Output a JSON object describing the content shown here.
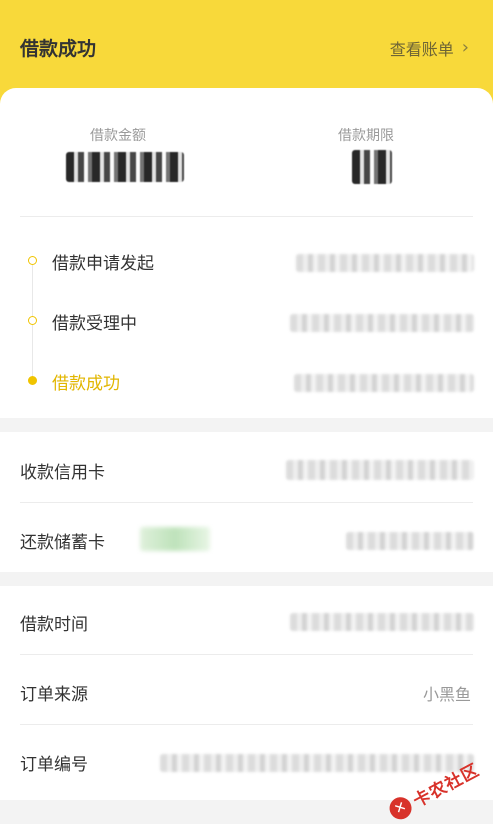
{
  "header": {
    "title": "借款成功",
    "view_bill_label": "查看账单",
    "chevron": "chevron-right-icon"
  },
  "summary": {
    "amount_label": "借款金额",
    "term_label": "借款期限"
  },
  "progress": {
    "steps": [
      {
        "label": "借款申请发起",
        "state": "done"
      },
      {
        "label": "借款受理中",
        "state": "done"
      },
      {
        "label": "借款成功",
        "state": "current"
      }
    ]
  },
  "cards": {
    "receive_label": "收款信用卡",
    "repay_label": "还款储蓄卡"
  },
  "order": {
    "time_label": "借款时间",
    "source_label": "订单来源",
    "source_value": "小黑鱼",
    "number_label": "订单编号"
  },
  "watermark": {
    "text": "卡农社区",
    "icon": "kanong-logo-icon",
    "color": "#d8322a"
  },
  "colors": {
    "accent": "#f8d93a",
    "step_active": "#e2b600"
  }
}
